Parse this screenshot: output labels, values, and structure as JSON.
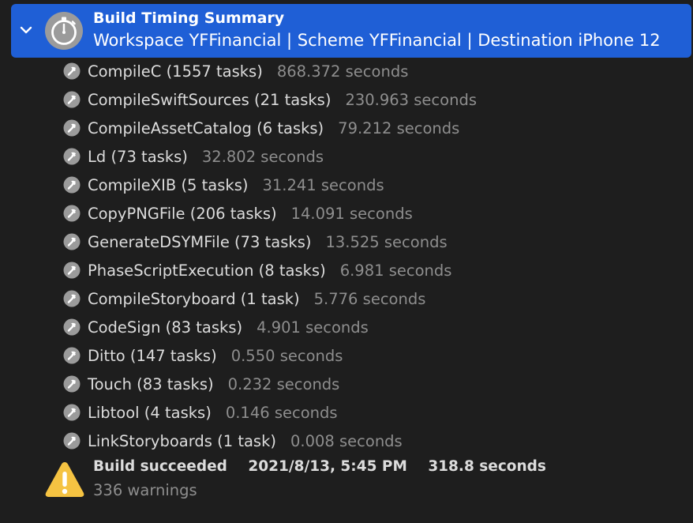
{
  "summary": {
    "title": "Build Timing Summary",
    "subtitle": "Workspace YFFinancial | Scheme YFFinancial | Destination iPhone 12",
    "icon": "stopwatch-icon",
    "accent_color": "#1f5fd6"
  },
  "tasks": [
    {
      "name": "CompileC (1557 tasks)",
      "time": "868.372 seconds"
    },
    {
      "name": "CompileSwiftSources (21 tasks)",
      "time": "230.963 seconds"
    },
    {
      "name": "CompileAssetCatalog (6 tasks)",
      "time": "79.212 seconds"
    },
    {
      "name": "Ld (73 tasks)",
      "time": "32.802 seconds"
    },
    {
      "name": "CompileXIB (5 tasks)",
      "time": "31.241 seconds"
    },
    {
      "name": "CopyPNGFile (206 tasks)",
      "time": "14.091 seconds"
    },
    {
      "name": "GenerateDSYMFile (73 tasks)",
      "time": "13.525 seconds"
    },
    {
      "name": "PhaseScriptExecution (8 tasks)",
      "time": "6.981 seconds"
    },
    {
      "name": "CompileStoryboard (1 task)",
      "time": "5.776 seconds"
    },
    {
      "name": "CodeSign (83 tasks)",
      "time": "4.901 seconds"
    },
    {
      "name": "Ditto (147 tasks)",
      "time": "0.550 seconds"
    },
    {
      "name": "Touch (83 tasks)",
      "time": "0.232 seconds"
    },
    {
      "name": "Libtool (4 tasks)",
      "time": "0.146 seconds"
    },
    {
      "name": "LinkStoryboards (1 task)",
      "time": "0.008 seconds"
    }
  ],
  "result": {
    "status": "Build succeeded",
    "timestamp": "2021/8/13, 5:45 PM",
    "duration": "318.8 seconds",
    "warnings": "336 warnings",
    "icon": "warning-icon",
    "warning_color": "#f5c342"
  }
}
